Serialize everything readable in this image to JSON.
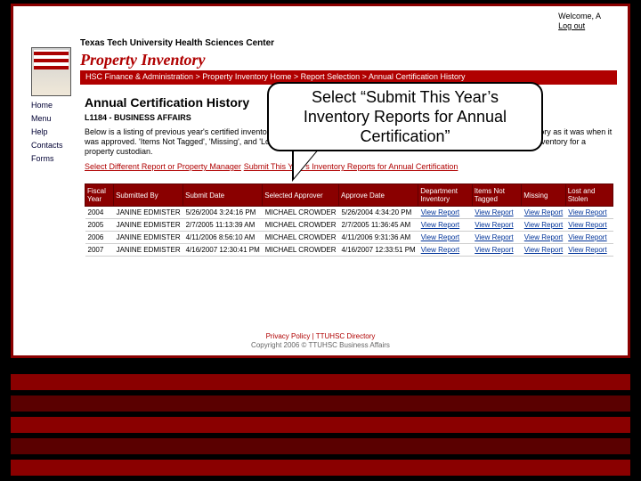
{
  "welcome": {
    "user": "Welcome, A",
    "logout": "Log out"
  },
  "university": "Texas Tech University Health Sciences Center",
  "app_title": "Property Inventory",
  "breadcrumb": "HSC Finance & Administration > Property Inventory Home > Report Selection > Annual Certification History",
  "sidebar": {
    "items": [
      "Home",
      "Menu",
      "Help",
      "Contacts",
      "Forms"
    ]
  },
  "page": {
    "heading": "Annual Certification History",
    "dept": "L1184 - BUSINESS AFFAIRS",
    "blurb": "Below is a listing of previous year's certified inventory reports for this department. Clicking on 'View Report' will display the inventory as it was when it was approved. 'Items Not Tagged', 'Missing', and 'Lost and Stolen' reports were submitted for certification. To submit this year's inventory for a property custodian.",
    "select_diff": "Select Different Report or Property Manager",
    "submit_link": "Submit This Year's Inventory Reports for Annual Certification"
  },
  "table": {
    "headers": [
      "Fiscal Year",
      "Submitted By",
      "Submit Date",
      "Selected Approver",
      "Approve Date",
      "Department Inventory",
      "Items Not Tagged",
      "Missing",
      "Lost and Stolen"
    ],
    "rows": [
      {
        "fy": "2004",
        "sub_by": "JANINE EDMISTER",
        "sub_date": "5/26/2004 3:24:16 PM",
        "approver": "MICHAEL CROWDER",
        "app_date": "5/26/2004 4:34:20 PM",
        "links": [
          "View Report",
          "View Report",
          "View Report",
          "View Report"
        ]
      },
      {
        "fy": "2005",
        "sub_by": "JANINE EDMISTER",
        "sub_date": "2/7/2005 11:13:39 AM",
        "approver": "MICHAEL CROWDER",
        "app_date": "2/7/2005 11:36:45 AM",
        "links": [
          "View Report",
          "View Report",
          "View Report",
          "View Report"
        ]
      },
      {
        "fy": "2006",
        "sub_by": "JANINE EDMISTER",
        "sub_date": "4/11/2006 8:56:10 AM",
        "approver": "MICHAEL CROWDER",
        "app_date": "4/11/2006 9:31:36 AM",
        "links": [
          "View Report",
          "View Report",
          "View Report",
          "View Report"
        ]
      },
      {
        "fy": "2007",
        "sub_by": "JANINE EDMISTER",
        "sub_date": "4/16/2007 12:30:41 PM",
        "approver": "MICHAEL CROWDER",
        "app_date": "4/16/2007 12:33:51 PM",
        "links": [
          "View Report",
          "View Report",
          "View Report",
          "View Report"
        ]
      }
    ]
  },
  "footer": {
    "links": "Privacy Policy | TTUHSC Directory",
    "copy": "Copyright 2006 © TTUHSC Business Affairs"
  },
  "callout": "Select “Submit This Year’s Inventory Reports for Annual Certification”"
}
